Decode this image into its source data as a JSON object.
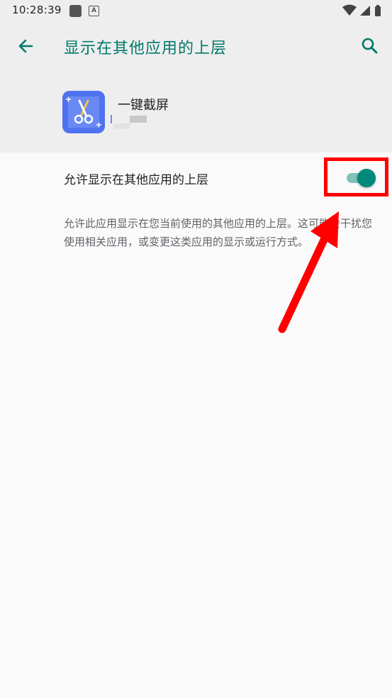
{
  "status_bar": {
    "time": "10:28:39",
    "notif_2_letter": "A"
  },
  "app_bar": {
    "title": "显示在其他应用的上层",
    "back_icon": "arrow-left-icon",
    "search_icon": "search-icon"
  },
  "app_info": {
    "name": "一键截屏",
    "icon": "scissors-screenshot-icon"
  },
  "setting": {
    "label": "允许显示在其他应用的上层",
    "enabled": true
  },
  "description": "允许此应用显示在您当前使用的其他应用的上层。这可能会干扰您使用相关应用，或变更这类应用的显示或运行方式。",
  "colors": {
    "accent": "#00796b",
    "toggle_thumb": "#00897b",
    "toggle_track": "#80c2b9",
    "app_icon_bg": "#4f73f0",
    "annotation": "#ff0000"
  }
}
